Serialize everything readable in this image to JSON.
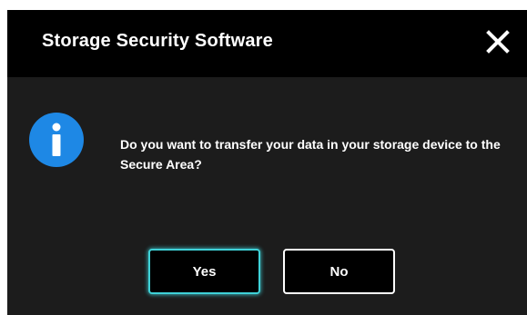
{
  "dialog": {
    "title": "Storage Security Software",
    "close_icon": "close-icon",
    "info_icon": "info-icon",
    "message": "Do you want to transfer your data in your storage device to the Secure Area?",
    "buttons": {
      "yes_label": "Yes",
      "no_label": "No"
    }
  },
  "colors": {
    "titlebar_bg": "#000000",
    "body_bg": "#1c1c1c",
    "info_blue": "#1e88e5",
    "focus_cyan": "#3fd2d8",
    "text": "#ffffff"
  }
}
